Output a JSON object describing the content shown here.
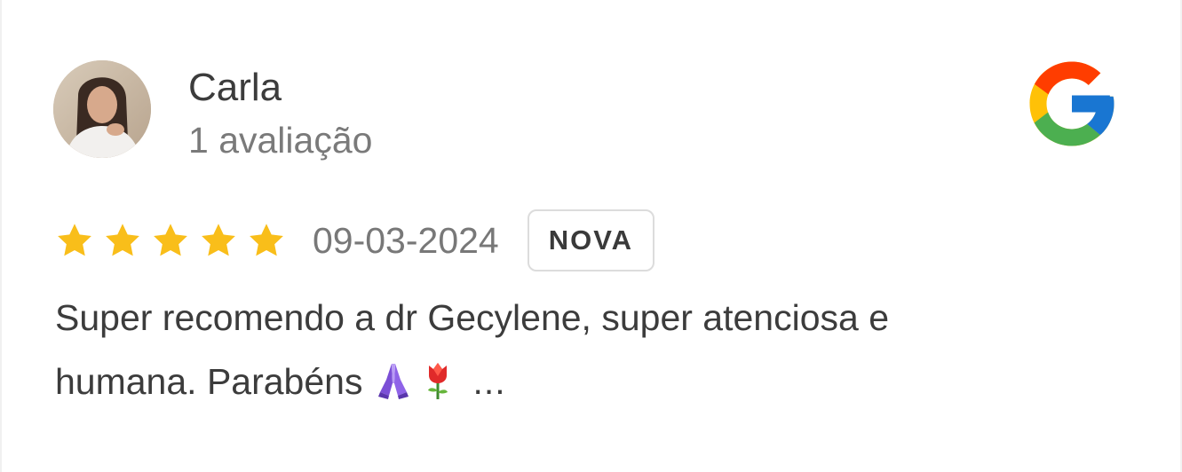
{
  "reviewer": {
    "name": "Carla",
    "review_count": "1 avaliação",
    "avatar": "avatar-photo"
  },
  "source": {
    "icon": "google-g-icon",
    "colors": {
      "blue": "#4285F4",
      "red": "#EA4335",
      "yellow": "#FBBC05",
      "green": "#34A853"
    }
  },
  "review": {
    "rating": 5,
    "max_rating": 5,
    "star_color": "#F9BE1A",
    "date": "09-03-2024",
    "badge": "NOVA",
    "text_line1": "Super recomendo a dr Gecylene, super atenciosa e",
    "text_line2": "humana. Parabéns",
    "emojis": [
      "praying-hands-icon",
      "tulip-icon"
    ],
    "ellipsis": "..."
  }
}
